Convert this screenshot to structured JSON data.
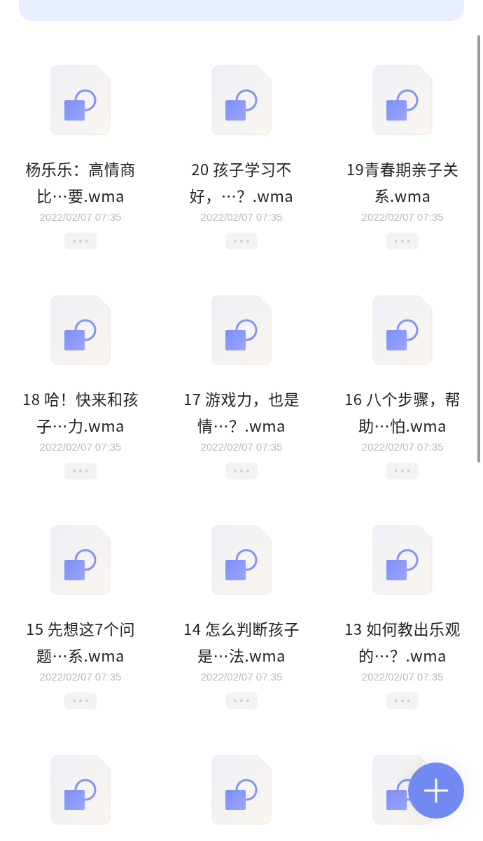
{
  "files": [
    {
      "kind": "file",
      "name": "杨乐乐：高情商比…要.wma",
      "date": "2022/02/07 07:35"
    },
    {
      "kind": "file",
      "name": "20 孩子学习不好，…？.wma",
      "date": "2022/02/07 07:35"
    },
    {
      "kind": "file",
      "name": "19青春期亲子关系.wma",
      "date": "2022/02/07 07:35"
    },
    {
      "kind": "file",
      "name": "18 哈！快来和孩子…力.wma",
      "date": "2022/02/07 07:35"
    },
    {
      "kind": "file",
      "name": "17 游戏力，也是情…？.wma",
      "date": "2022/02/07 07:35"
    },
    {
      "kind": "file",
      "name": "16 八个步骤，帮助…怕.wma",
      "date": "2022/02/07 07:35"
    },
    {
      "kind": "file",
      "name": "15 先想这7个问题…系.wma",
      "date": "2022/02/07 07:35"
    },
    {
      "kind": "file",
      "name": "14 怎么判断孩子是…法.wma",
      "date": "2022/02/07 07:35"
    },
    {
      "kind": "file",
      "name": "13 如何教出乐观的…？.wma",
      "date": "2022/02/07 07:35"
    },
    {
      "kind": "partial"
    },
    {
      "kind": "partial"
    },
    {
      "kind": "partial"
    }
  ]
}
